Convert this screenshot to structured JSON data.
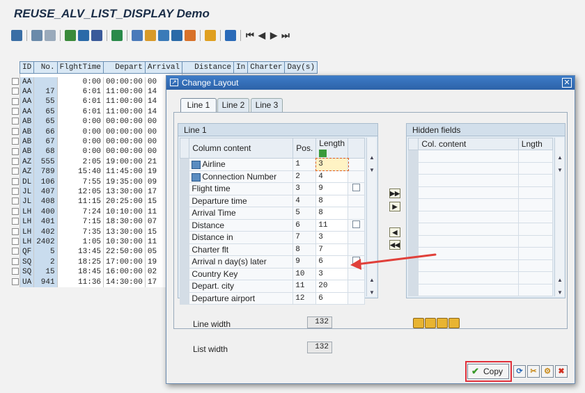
{
  "title": "REUSE_ALV_LIST_DISPLAY Demo",
  "toolbar": {
    "icons": [
      "details-icon",
      "select-all-icon",
      "deselect-all-icon",
      "sort-asc-icon",
      "sort-desc-icon",
      "filter-icon",
      "sum-icon",
      "subtotal-icon",
      "print-preview-icon",
      "export-icon",
      "word-icon",
      "layout-icon",
      "layout-choose-icon",
      "grid-icon",
      "info-icon"
    ],
    "nav": [
      "K4",
      "◀",
      "▶",
      "▶I"
    ]
  },
  "list": {
    "headers": [
      "ID",
      "No.",
      "FlghtTime",
      "Depart",
      "Arrival",
      "Distance",
      "In",
      "Charter",
      "Day(s)"
    ],
    "rows": [
      {
        "id": "AA",
        "no": "",
        "ft": "0:00",
        "dep": "00:00:00",
        "arr": "00"
      },
      {
        "id": "AA",
        "no": "17",
        "ft": "6:01",
        "dep": "11:00:00",
        "arr": "14"
      },
      {
        "id": "AA",
        "no": "55",
        "ft": "6:01",
        "dep": "11:00:00",
        "arr": "14"
      },
      {
        "id": "AA",
        "no": "65",
        "ft": "6:01",
        "dep": "11:00:00",
        "arr": "14"
      },
      {
        "id": "AB",
        "no": "65",
        "ft": "0:00",
        "dep": "00:00:00",
        "arr": "00"
      },
      {
        "id": "AB",
        "no": "66",
        "ft": "0:00",
        "dep": "00:00:00",
        "arr": "00"
      },
      {
        "id": "AB",
        "no": "67",
        "ft": "0:00",
        "dep": "00:00:00",
        "arr": "00"
      },
      {
        "id": "AB",
        "no": "68",
        "ft": "0:00",
        "dep": "00:00:00",
        "arr": "00"
      },
      {
        "id": "AZ",
        "no": "555",
        "ft": "2:05",
        "dep": "19:00:00",
        "arr": "21"
      },
      {
        "id": "AZ",
        "no": "789",
        "ft": "15:40",
        "dep": "11:45:00",
        "arr": "19"
      },
      {
        "id": "DL",
        "no": "106",
        "ft": "7:55",
        "dep": "19:35:00",
        "arr": "09"
      },
      {
        "id": "JL",
        "no": "407",
        "ft": "12:05",
        "dep": "13:30:00",
        "arr": "17"
      },
      {
        "id": "JL",
        "no": "408",
        "ft": "11:15",
        "dep": "20:25:00",
        "arr": "15"
      },
      {
        "id": "LH",
        "no": "400",
        "ft": "7:24",
        "dep": "10:10:00",
        "arr": "11"
      },
      {
        "id": "LH",
        "no": "401",
        "ft": "7:15",
        "dep": "18:30:00",
        "arr": "07"
      },
      {
        "id": "LH",
        "no": "402",
        "ft": "7:35",
        "dep": "13:30:00",
        "arr": "15"
      },
      {
        "id": "LH",
        "no": "2402",
        "ft": "1:05",
        "dep": "10:30:00",
        "arr": "11"
      },
      {
        "id": "QF",
        "no": "5",
        "ft": "13:45",
        "dep": "22:50:00",
        "arr": "05"
      },
      {
        "id": "SQ",
        "no": "2",
        "ft": "18:25",
        "dep": "17:00:00",
        "arr": "19"
      },
      {
        "id": "SQ",
        "no": "15",
        "ft": "18:45",
        "dep": "16:00:00",
        "arr": "02"
      },
      {
        "id": "UA",
        "no": "941",
        "ft": "11:36",
        "dep": "14:30:00",
        "arr": "17"
      }
    ]
  },
  "dialog": {
    "title": "Change Layout",
    "tabs": [
      "Line 1",
      "Line 2",
      "Line 3"
    ],
    "group_title": "Line 1",
    "columns": {
      "content": "Column content",
      "pos": "Pos.",
      "length": "Length"
    },
    "rows": [
      {
        "name": "Airline",
        "pos": "1",
        "len": "3",
        "icon": true,
        "chk": false
      },
      {
        "name": "Connection Number",
        "pos": "2",
        "len": "4",
        "icon": true,
        "chk": false
      },
      {
        "name": "Flight time",
        "pos": "3",
        "len": "9",
        "icon": false,
        "chk": true
      },
      {
        "name": "Departure time",
        "pos": "4",
        "len": "8",
        "icon": false,
        "chk": false
      },
      {
        "name": "Arrival Time",
        "pos": "5",
        "len": "8",
        "icon": false,
        "chk": false
      },
      {
        "name": "Distance",
        "pos": "6",
        "len": "11",
        "icon": false,
        "chk": true
      },
      {
        "name": "Distance in",
        "pos": "7",
        "len": "3",
        "icon": false,
        "chk": false
      },
      {
        "name": "Charter flt",
        "pos": "8",
        "len": "7",
        "icon": false,
        "chk": false
      },
      {
        "name": "Arrival n day(s) later",
        "pos": "9",
        "len": "6",
        "icon": false,
        "chk": true
      },
      {
        "name": "Country Key",
        "pos": "10",
        "len": "3",
        "icon": false,
        "chk": false
      },
      {
        "name": "Depart. city",
        "pos": "11",
        "len": "20",
        "icon": false,
        "chk": false
      },
      {
        "name": "Departure airport",
        "pos": "12",
        "len": "6",
        "icon": false,
        "chk": false
      }
    ],
    "hidden": {
      "title": "Hidden fields",
      "col_content": "Col. content",
      "col_length": "Lngth"
    },
    "line_width_label": "Line width",
    "line_width": "132",
    "list_width_label": "List width",
    "list_width": "132",
    "copy_label": "Copy",
    "colors": {
      "titlebar": "#2d62a8",
      "highlight": "#e0303a"
    }
  }
}
